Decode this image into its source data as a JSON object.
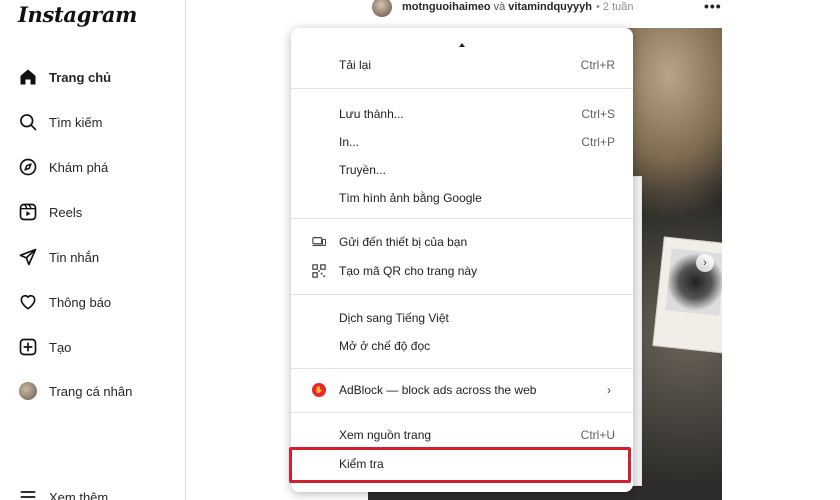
{
  "app": {
    "logo": "Instagram"
  },
  "sidebar": {
    "items": [
      {
        "label": "Trang chủ",
        "icon": "home-icon"
      },
      {
        "label": "Tìm kiếm",
        "icon": "search-icon"
      },
      {
        "label": "Khám phá",
        "icon": "compass-icon"
      },
      {
        "label": "Reels",
        "icon": "reels-icon"
      },
      {
        "label": "Tin nhắn",
        "icon": "send-icon"
      },
      {
        "label": "Thông báo",
        "icon": "heart-icon"
      },
      {
        "label": "Tạo",
        "icon": "plus-square-icon"
      },
      {
        "label": "Trang cá nhân",
        "icon": "avatar"
      },
      {
        "label": "Xem thêm",
        "icon": "menu-icon"
      }
    ]
  },
  "post": {
    "user1": "motnguoihaimeo",
    "and": "và",
    "user2": "vitamindquyyyh",
    "time": "• 2 tuần",
    "more": "•••"
  },
  "context_menu": {
    "items": [
      {
        "label": "Tải lại",
        "shortcut": "Ctrl+R"
      },
      {
        "label": "Lưu thành...",
        "shortcut": "Ctrl+S"
      },
      {
        "label": "In...",
        "shortcut": "Ctrl+P"
      },
      {
        "label": "Truyền...",
        "shortcut": ""
      },
      {
        "label": "Tìm hình ảnh bằng Google",
        "shortcut": ""
      },
      {
        "label": "Gửi đến thiết bị của bạn",
        "shortcut": "",
        "icon": "devices-icon"
      },
      {
        "label": "Tạo mã QR cho trang này",
        "shortcut": "",
        "icon": "qr-code-icon"
      },
      {
        "label": "Dịch sang Tiếng Việt",
        "shortcut": ""
      },
      {
        "label": "Mở ở chế độ đọc",
        "shortcut": ""
      },
      {
        "label": "AdBlock — block ads across the web",
        "shortcut": "",
        "icon": "adblock-icon",
        "submenu": "›"
      },
      {
        "label": "Xem nguồn trang",
        "shortcut": "Ctrl+U"
      },
      {
        "label": "Kiểm tra",
        "shortcut": ""
      }
    ]
  },
  "colors": {
    "highlight": "#d31f30",
    "adblock": "#e8242f"
  }
}
